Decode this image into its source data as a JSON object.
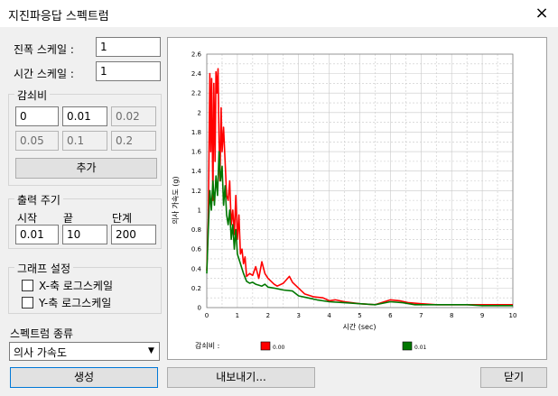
{
  "window": {
    "title": "지진파응답 스펙트럼",
    "close_icon": "×"
  },
  "amplitude_scale": {
    "label": "진폭 스케일 :",
    "value": "1"
  },
  "time_scale": {
    "label": "시간 스케일 :",
    "value": "1"
  },
  "damping": {
    "group_title": "감쇠비",
    "values": [
      "0",
      "0.01",
      "0.02",
      "0.05",
      "0.1",
      "0.2"
    ],
    "add_label": "추가"
  },
  "output_period": {
    "group_title": "출력 주기",
    "start_label": "시작",
    "end_label": "끝",
    "step_label": "단계",
    "start": "0.01",
    "end": "10",
    "step": "200"
  },
  "graph_settings": {
    "group_title": "그래프 설정",
    "x_log_label": "X-축 로그스케일",
    "y_log_label": "Y-축 로그스케일",
    "x_log": false,
    "y_log": false
  },
  "spectrum_type": {
    "label": "스펙트럼 종류",
    "selected": "의사 가속도"
  },
  "buttons": {
    "generate": "생성",
    "export": "내보내기...",
    "close": "닫기"
  },
  "chart_data": {
    "type": "line",
    "xlabel": "시간 (sec)",
    "ylabel": "의사 가속도 (g)",
    "xlim": [
      0,
      10
    ],
    "ylim": [
      0,
      2.6
    ],
    "x_ticks": [
      "0",
      "1",
      "2",
      "3",
      "4",
      "5",
      "6",
      "7",
      "8",
      "9",
      "10"
    ],
    "y_ticks": [
      "0",
      "0.2",
      "0.4",
      "0.6",
      "0.8",
      "1",
      "1.2",
      "1.4",
      "1.6",
      "1.8",
      "2",
      "2.2",
      "2.4",
      "2.6"
    ],
    "grid": true,
    "legend_title": "감쇠비 :",
    "series": [
      {
        "name": "0.00",
        "color": "#ff0000",
        "x": [
          0.0,
          0.05,
          0.1,
          0.13,
          0.16,
          0.2,
          0.23,
          0.27,
          0.3,
          0.33,
          0.37,
          0.4,
          0.43,
          0.47,
          0.5,
          0.55,
          0.6,
          0.65,
          0.7,
          0.75,
          0.8,
          0.85,
          0.9,
          0.95,
          1.0,
          1.05,
          1.1,
          1.15,
          1.2,
          1.25,
          1.3,
          1.4,
          1.5,
          1.6,
          1.7,
          1.8,
          1.9,
          2.0,
          2.1,
          2.2,
          2.3,
          2.5,
          2.7,
          2.8,
          3.0,
          3.2,
          3.5,
          3.8,
          4.0,
          4.2,
          4.5,
          5.0,
          5.5,
          6.0,
          6.3,
          6.6,
          7.0,
          7.5,
          8.0,
          8.5,
          9.0,
          9.5,
          10.0
        ],
        "y": [
          0.38,
          0.9,
          2.4,
          1.6,
          2.35,
          1.1,
          2.3,
          1.5,
          2.42,
          2.2,
          2.45,
          1.7,
          1.3,
          2.05,
          1.6,
          1.85,
          1.5,
          1.15,
          1.1,
          1.3,
          0.85,
          1.0,
          0.75,
          1.15,
          0.7,
          0.95,
          0.55,
          0.6,
          0.45,
          0.52,
          0.32,
          0.35,
          0.33,
          0.42,
          0.3,
          0.47,
          0.35,
          0.3,
          0.27,
          0.24,
          0.22,
          0.25,
          0.32,
          0.26,
          0.2,
          0.14,
          0.11,
          0.1,
          0.07,
          0.08,
          0.06,
          0.04,
          0.03,
          0.08,
          0.07,
          0.05,
          0.04,
          0.03,
          0.03,
          0.03,
          0.03,
          0.03,
          0.03
        ]
      },
      {
        "name": "0.01",
        "color": "#007700",
        "x": [
          0.0,
          0.05,
          0.1,
          0.15,
          0.2,
          0.25,
          0.3,
          0.35,
          0.4,
          0.45,
          0.5,
          0.55,
          0.6,
          0.65,
          0.7,
          0.75,
          0.8,
          0.85,
          0.9,
          0.95,
          1.0,
          1.1,
          1.2,
          1.3,
          1.4,
          1.5,
          1.6,
          1.7,
          1.8,
          1.9,
          2.0,
          2.2,
          2.5,
          2.8,
          3.0,
          3.3,
          3.6,
          4.0,
          4.5,
          5.0,
          5.5,
          6.0,
          6.4,
          6.8,
          7.5,
          8.0,
          8.5,
          9.0,
          9.5,
          10.0
        ],
        "y": [
          0.35,
          0.8,
          1.2,
          1.0,
          1.3,
          1.05,
          1.35,
          1.15,
          1.6,
          1.3,
          1.45,
          1.05,
          1.25,
          0.95,
          0.85,
          1.0,
          0.7,
          0.85,
          0.6,
          0.8,
          0.55,
          0.45,
          0.35,
          0.27,
          0.25,
          0.26,
          0.24,
          0.23,
          0.22,
          0.24,
          0.21,
          0.2,
          0.18,
          0.17,
          0.12,
          0.1,
          0.08,
          0.06,
          0.05,
          0.04,
          0.03,
          0.06,
          0.05,
          0.03,
          0.03,
          0.03,
          0.03,
          0.02,
          0.02,
          0.02
        ]
      }
    ]
  }
}
